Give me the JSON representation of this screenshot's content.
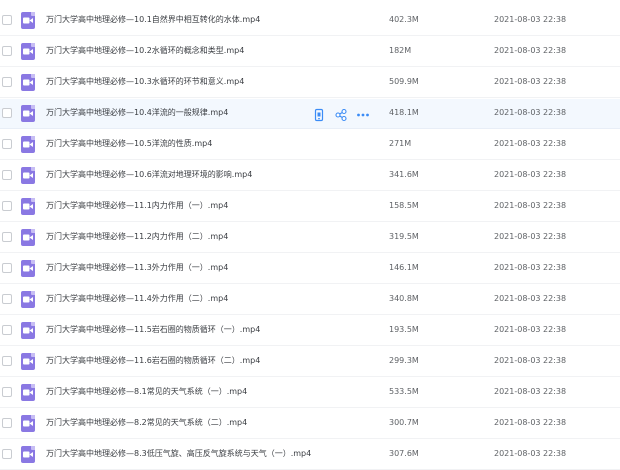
{
  "colors": {
    "video_icon": "#8a78e3",
    "action_icon": "#3b8cf6",
    "hover_row": "#f3f8fe"
  },
  "icons": {
    "file": "video-file-icon",
    "actions": [
      "phone-icon",
      "share-icon",
      "more-icon"
    ]
  },
  "files": [
    {
      "name": "万门大学高中地理必修—10.1自然界中相互转化的水体.mp4",
      "size": "402.3M",
      "date": "2021-08-03 22:38"
    },
    {
      "name": "万门大学高中地理必修—10.2水循环的概念和类型.mp4",
      "size": "182M",
      "date": "2021-08-03 22:38"
    },
    {
      "name": "万门大学高中地理必修—10.3水循环的环节和意义.mp4",
      "size": "509.9M",
      "date": "2021-08-03 22:38"
    },
    {
      "name": "万门大学高中地理必修—10.4洋流的一般规律.mp4",
      "size": "418.1M",
      "date": "2021-08-03 22:38"
    },
    {
      "name": "万门大学高中地理必修—10.5洋流的性质.mp4",
      "size": "271M",
      "date": "2021-08-03 22:38"
    },
    {
      "name": "万门大学高中地理必修—10.6洋流对地理环境的影响.mp4",
      "size": "341.6M",
      "date": "2021-08-03 22:38"
    },
    {
      "name": "万门大学高中地理必修—11.1内力作用（一）.mp4",
      "size": "158.5M",
      "date": "2021-08-03 22:38"
    },
    {
      "name": "万门大学高中地理必修—11.2内力作用（二）.mp4",
      "size": "319.5M",
      "date": "2021-08-03 22:38"
    },
    {
      "name": "万门大学高中地理必修—11.3外力作用（一）.mp4",
      "size": "146.1M",
      "date": "2021-08-03 22:38"
    },
    {
      "name": "万门大学高中地理必修—11.4外力作用（二）.mp4",
      "size": "340.8M",
      "date": "2021-08-03 22:38"
    },
    {
      "name": "万门大学高中地理必修—11.5岩石圈的物质循环（一）.mp4",
      "size": "193.5M",
      "date": "2021-08-03 22:38"
    },
    {
      "name": "万门大学高中地理必修—11.6岩石圈的物质循环（二）.mp4",
      "size": "299.3M",
      "date": "2021-08-03 22:38"
    },
    {
      "name": "万门大学高中地理必修—8.1常见的天气系统（一）.mp4",
      "size": "533.5M",
      "date": "2021-08-03 22:38"
    },
    {
      "name": "万门大学高中地理必修—8.2常见的天气系统（二）.mp4",
      "size": "300.7M",
      "date": "2021-08-03 22:38"
    },
    {
      "name": "万门大学高中地理必修—8.3低压气旋、高压反气旋系统与天气（一）.mp4",
      "size": "307.6M",
      "date": "2021-08-03 22:38"
    }
  ]
}
